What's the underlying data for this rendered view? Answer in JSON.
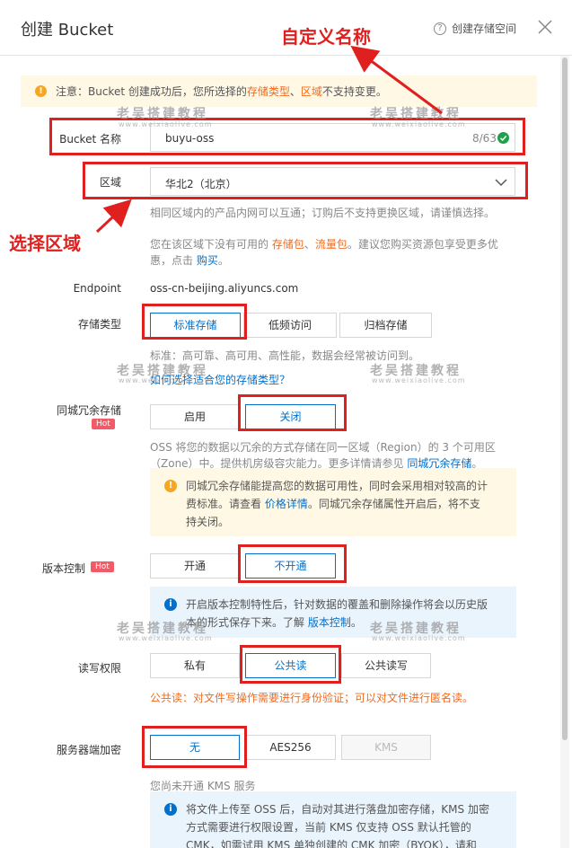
{
  "header": {
    "title": "创建 Bucket",
    "help_label": "创建存储空间",
    "help_icon": "?"
  },
  "notice": {
    "prefix": "注意：Bucket 创建成功后，您所选择的 ",
    "link1": "存储类型",
    "sep": "、",
    "link2": "区域",
    "suffix": " 不支持变更。"
  },
  "bucket_name": {
    "label": "Bucket 名称",
    "value": "buyu-oss",
    "counter": "8/63"
  },
  "region": {
    "label": "区域",
    "value": "华北2（北京）",
    "help1": "相同区域内的产品内网可以互通；订购后不支持更换区域，请谨慎选择。",
    "help2_prefix": "您在该区域下没有可用的 ",
    "help2_link1": "存储包",
    "help2_sep": "、",
    "help2_link2": "流量包",
    "help2_suffix": "。建议您购买资源包享受更多优",
    "help3_prefix": "惠，点击 ",
    "help3_link": "购买",
    "help3_suffix": "。"
  },
  "endpoint": {
    "label": "Endpoint",
    "value": "oss-cn-beijing.aliyuncs.com"
  },
  "storage_class": {
    "label": "存储类型",
    "options": [
      "标准存储",
      "低频访问",
      "归档存储"
    ],
    "selected": "标准存储",
    "desc": "标准：高可靠、高可用、高性能，数据会经常被访问到。",
    "link": "如何选择适合您的存储类型？"
  },
  "zone_redundancy": {
    "label": "同城冗余存储",
    "hot": "Hot",
    "options": [
      "启用",
      "关闭"
    ],
    "selected": "关闭",
    "desc1": "OSS 将您的数据以冗余的方式存储在同一区域（Region）的 3 个可用区",
    "desc2_prefix": "（Zone）中。提供机房级容灾能力。更多详情请参见 ",
    "desc2_link": "同城冗余存储",
    "desc2_suffix": "。",
    "tip1": "同城冗余存储能提高您的数据可用性，同时会采用相对较高的计",
    "tip2_prefix": "费标准。请查看 ",
    "tip2_link": "价格详情",
    "tip2_suffix": "。同城冗余存储属性开启后，将不支",
    "tip3": "持关闭。"
  },
  "versioning": {
    "label": "版本控制",
    "hot": "Hot",
    "options": [
      "开通",
      "不开通"
    ],
    "selected": "不开通",
    "tip1": "开启版本控制特性后，针对数据的覆盖和删除操作将会以历史版",
    "tip2_prefix": "本的形式保存下来。了解 ",
    "tip2_link": "版本控制",
    "tip2_suffix": "。"
  },
  "acl": {
    "label": "读写权限",
    "options": [
      "私有",
      "公共读",
      "公共读写"
    ],
    "selected": "公共读",
    "warning": "公共读：对文件写操作需要进行身份验证；可以对文件进行匿名读。"
  },
  "encryption": {
    "label": "服务器端加密",
    "options": [
      "无",
      "AES256",
      "KMS"
    ],
    "selected": "无",
    "note": "您尚未开通 KMS 服务",
    "tip1": "将文件上传至 OSS 后，自动对其进行落盘加密存储，KMS 加密",
    "tip2": "方式需要进行权限设置，当前 KMS 仅支持 OSS 默认托管的",
    "tip3": "CMK，如需试用 KMS 单独创建的 CMK 加密（BYOK），请和"
  },
  "annotations": {
    "name_callout": "自定义名称",
    "region_callout": "选择区域"
  },
  "watermark": {
    "text": "老吴搭建教程",
    "url": "www.weixiaolive.com"
  },
  "colors": {
    "accent": "#0070cc",
    "orange": "#f36b1c",
    "annotation_red": "#e0201f",
    "hot_pink": "#f25a67"
  }
}
